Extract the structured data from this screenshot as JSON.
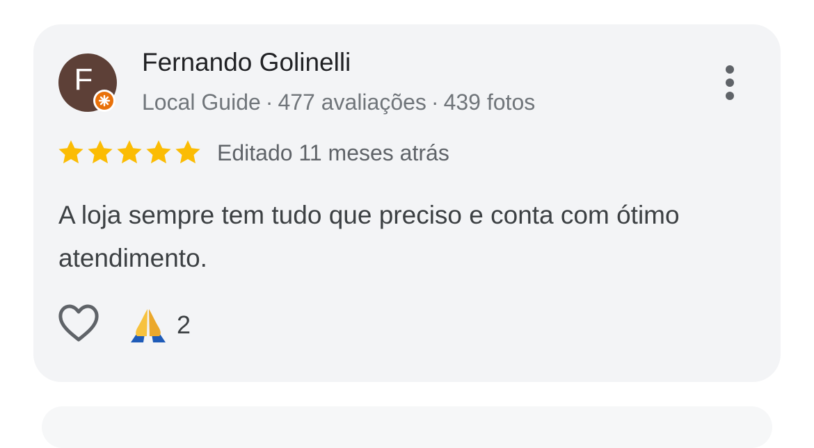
{
  "review": {
    "author": {
      "initial": "F",
      "name": "Fernando Golinelli",
      "badge_icon": "local-guide-icon",
      "level": "Local Guide",
      "reviews": "477 avaliações",
      "photos": "439 fotos",
      "separator": "·",
      "avatar_color": "#5d4037",
      "badge_color": "#e8710a"
    },
    "rating": 5,
    "rating_max": 5,
    "star_color": "#fbbc04",
    "date": "Editado 11 meses atrás",
    "text": "A loja sempre tem tudo que preciso e conta com ótimo atendimento.",
    "actions": {
      "more_icon": "more-vert-icon",
      "like_icon": "heart-outline-icon",
      "reaction_icon": "folded-hands-emoji",
      "reaction_count": "2"
    }
  }
}
